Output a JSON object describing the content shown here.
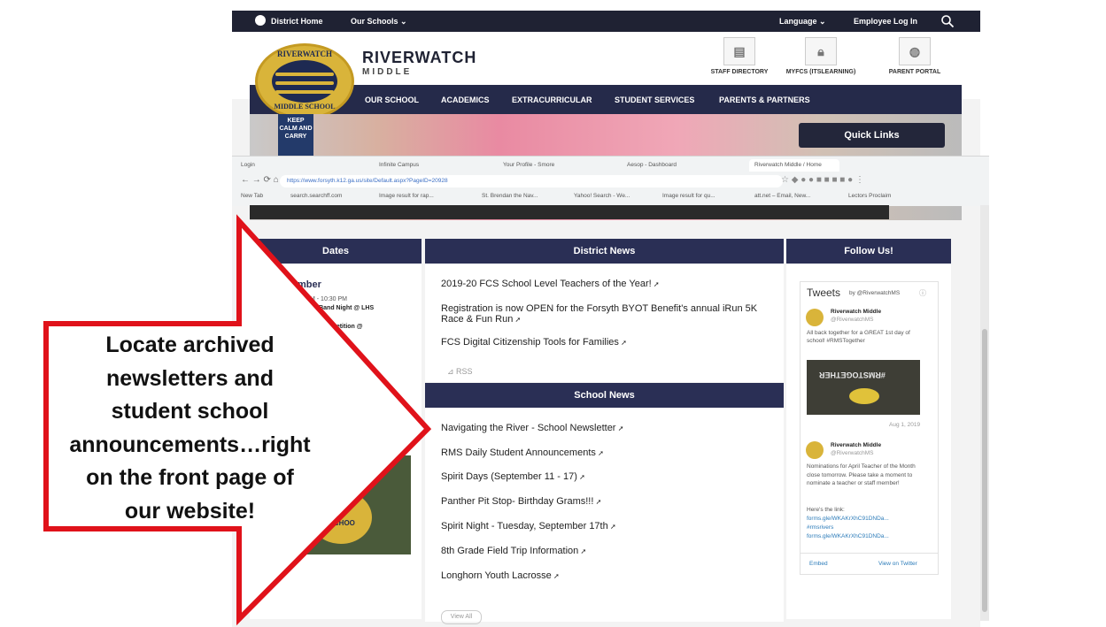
{
  "topbar": {
    "district_home": "District Home",
    "our_schools": "Our Schools ⌄",
    "language": "Language ⌄",
    "employee_login": "Employee Log In"
  },
  "header": {
    "name": "RIVERWATCH",
    "sub": "MIDDLE",
    "logo_top": "RIVERWATCH",
    "logo_bottom": "MIDDLE SCHOOL",
    "quick_icons": [
      {
        "label": "STAFF DIRECTORY",
        "icon": "directory-icon"
      },
      {
        "label": "MYFCS (ITSLEARNING)",
        "icon": "lock-icon"
      },
      {
        "label": "PARENT PORTAL",
        "icon": "globe-icon"
      }
    ]
  },
  "nav": [
    "OUR SCHOOL",
    "ACADEMICS",
    "EXTRACURRICULAR",
    "STUDENT SERVICES",
    "PARENTS & PARTNERS"
  ],
  "hero": {
    "keep_calm": "KEEP CALM AND CARRY",
    "quick_links": "Quick Links"
  },
  "browser": {
    "tabs": [
      "Login",
      "Infinite Campus",
      "Your Profile - Smore",
      "Aesop - Dashboard",
      "Riverwatch Middle / Home"
    ],
    "url": "https://www.forsyth.k12.ga.us/site/Default.aspx?PageID=20928",
    "bookmarks": [
      "New Tab",
      "search.searchff.com",
      "Image result for rap...",
      "St. Brendan the Nav...",
      "Yahoo! Search - We...",
      "Image result for qu...",
      "att.net – Email, New...",
      "Lectors Proclaim"
    ]
  },
  "dates": {
    "title": "Dates",
    "month": "mber",
    "time": "M - 10:30 PM",
    "event1": "de Band Night @ LHS",
    "event2": "Competition @",
    "logo_frag": "E SCHOO"
  },
  "district_news": {
    "title": "District News",
    "items": [
      "2019-20 FCS School Level Teachers of the Year!",
      "Registration is now OPEN for the Forsyth BYOT Benefit's annual iRun 5K Race & Fun Run",
      "FCS Digital Citizenship Tools for Families"
    ],
    "rss": "RSS"
  },
  "school_news": {
    "title": "School News",
    "items": [
      "Navigating the River - School Newsletter",
      "RMS Daily Student Announcements",
      "Spirit Days (September 11 - 17)",
      "Panther Pit Stop- Birthday Grams!!!",
      "Spirit Night - Tuesday, September 17th",
      "8th Grade Field Trip Information",
      "Longhorn Youth Lacrosse"
    ],
    "view_all": "View All"
  },
  "follow": {
    "title": "Follow Us!",
    "tweets_label": "Tweets",
    "tweets_by": "by @RiverwatchMS",
    "tweet1": {
      "name": "Riverwatch Middle",
      "handle": "@RiverwatchMS",
      "text": "All back together for a GREAT 1st day of school! #RMSTogether",
      "shirt": "#RMSTOGETHER",
      "date": "Aug 1, 2019"
    },
    "tweet2": {
      "name": "Riverwatch Middle",
      "handle": "@RiverwatchMS",
      "text": "Nominations for April Teacher of the Month close tomorrow. Please take a moment to nominate a teacher or staff member!",
      "link_intro": "Here's the link:",
      "link1": "forms.gle/WKAKrXhC91DNDa...",
      "tag": "#rmsrivers",
      "link2": "forms.gle/WKAKrXhC91DNDa..."
    },
    "embed": "Embed",
    "view_on_twitter": "View on Twitter"
  },
  "callout": {
    "lines": [
      "Locate archived",
      "newsletters and",
      "student school",
      "announcements…right",
      "on the front page of",
      "our website!"
    ]
  },
  "colors": {
    "nav": "#252a4a",
    "panel_head": "#2a2f55",
    "arrow_red": "#e0121a"
  }
}
